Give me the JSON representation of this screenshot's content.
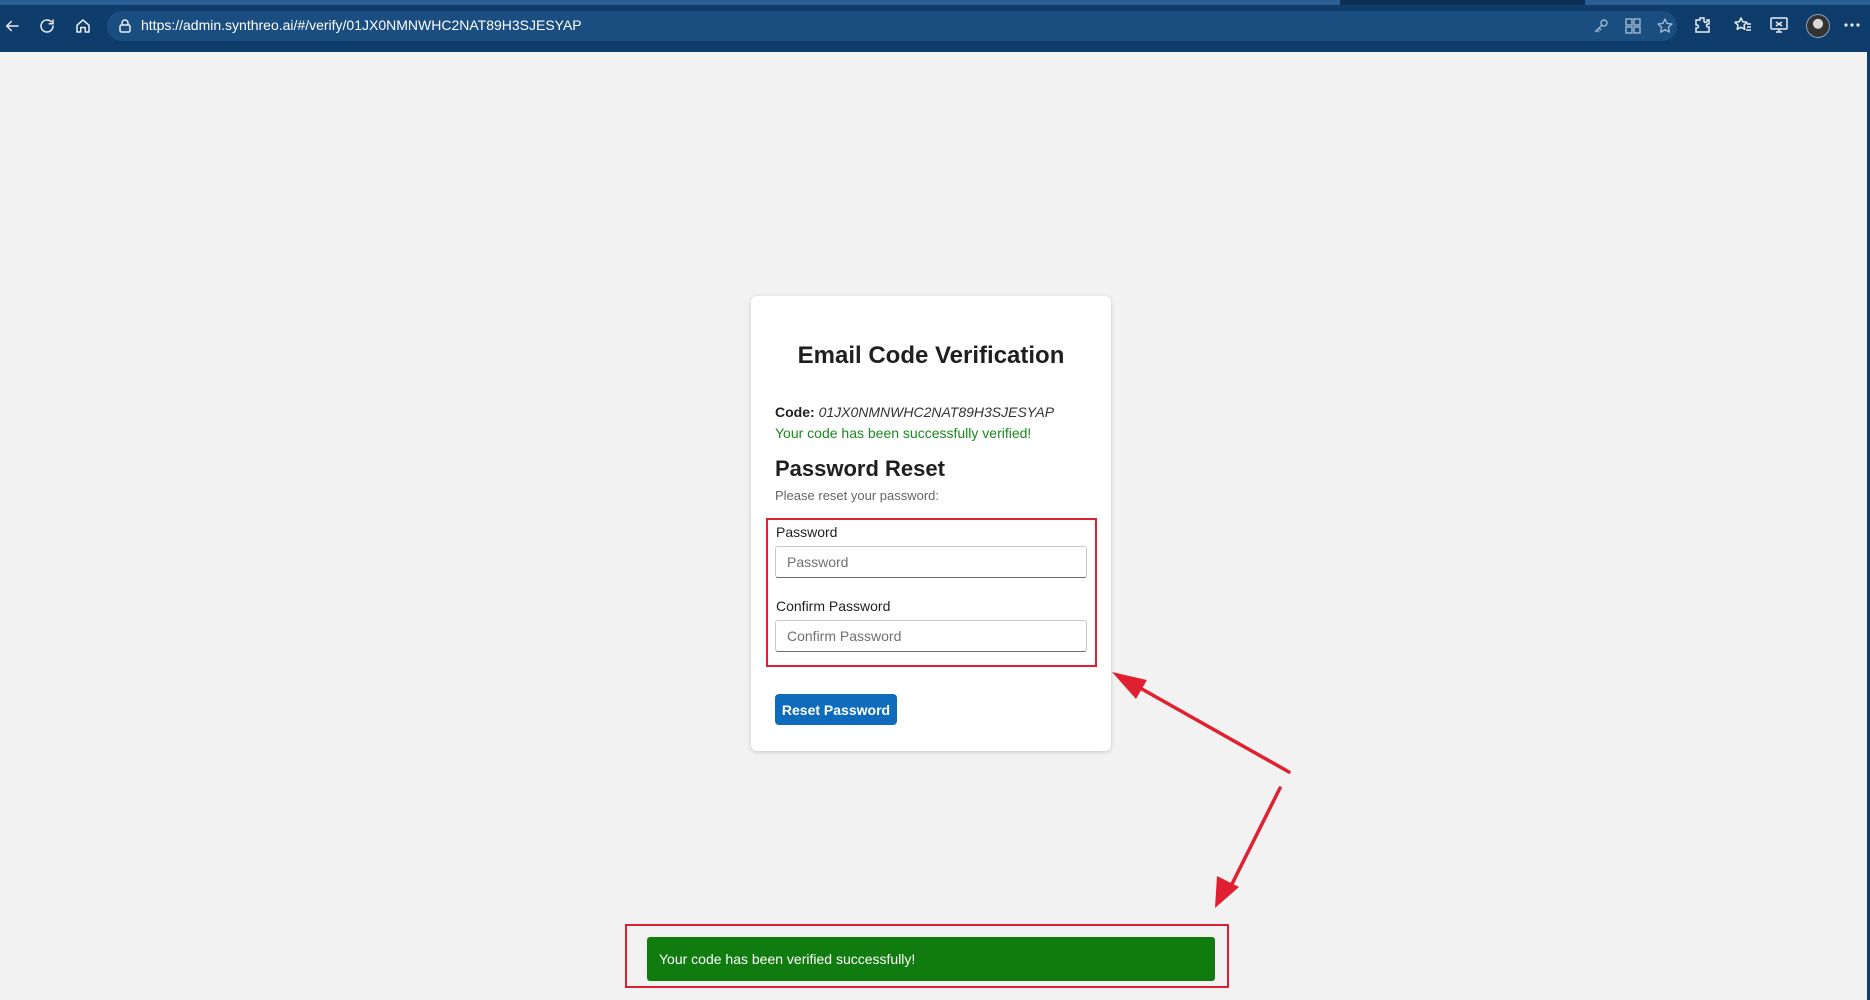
{
  "browser": {
    "url": "https://admin.synthreo.ai/#/verify/01JX0NMNWHC2NAT89H3SJESYAP"
  },
  "card": {
    "title": "Email Code Verification",
    "code_label": "Code:",
    "code_value": "01JX0NMNWHC2NAT89H3SJESYAP",
    "verified_message": "Your code has been successfully verified!",
    "section_title": "Password Reset",
    "section_subtitle": "Please reset your password:",
    "password_label": "Password",
    "password_placeholder": "Password",
    "password_value": "",
    "confirm_label": "Confirm Password",
    "confirm_placeholder": "Confirm Password",
    "confirm_value": "",
    "reset_button_label": "Reset Password"
  },
  "toast": {
    "message": "Your code has been verified successfully!"
  },
  "colors": {
    "accent": "#0f6cbd",
    "success_text": "#1a8a1a",
    "toast_background": "#107c10",
    "annotation": "#e02030",
    "browser_chrome": "#0f3d6b"
  }
}
